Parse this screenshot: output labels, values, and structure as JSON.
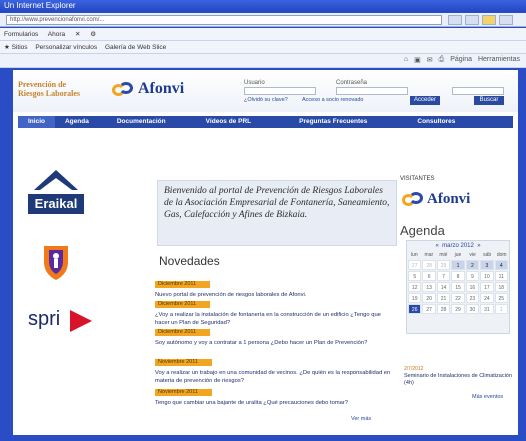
{
  "browser": {
    "title": "Un Internet Explorer",
    "url": "http://www.prevencionafonvi.com/...",
    "menus": [
      "Formularios",
      "Ahora",
      "✕",
      "⚙"
    ],
    "favorites": [
      "★ Sitios",
      "Personalizar vínculos",
      "Galería de Web Slice"
    ],
    "cmd_tools": [
      "⌂",
      "▣",
      "✉",
      "⎙",
      "Página",
      "Herramientas"
    ]
  },
  "site": {
    "prevencion_line1": "Prevención de",
    "prevencion_line2": "Riesgos Laborales",
    "brand": "Afonvi",
    "search": {
      "label_user": "Usuario",
      "label_pass": "Contraseña",
      "link_forgot": "¿Olvidó su clave?",
      "link_register": "Acceso a socio renovado",
      "btn_login": "Acceder",
      "btn_search": "Buscar"
    },
    "nav": [
      "Inicio",
      "Agenda",
      "Documentación",
      "Vídeos de PRL",
      "Preguntas Frecuentes",
      "Consultores"
    ],
    "welcome": "Bienvenido al portal de Prevención de Riesgos Laborales de la Asociación Empresarial de Fontanería, Saneamiento, Gas, Calefacción y Afines de Bizkaia.",
    "novedades_title": "Novedades",
    "news": [
      {
        "date": "Diciembre 2011",
        "text": "Nuevo portal de prevención de riesgos laborales de Afonvi."
      },
      {
        "date": "Diciembre 2011",
        "text": "¿Voy a realizar la instalación de fontanería en la construcción de un edificio ¿Tengo que hacer un Plan de Seguridad?"
      },
      {
        "date": "Diciembre 2011",
        "text": "Soy autónomo y voy a contratar a 1 persona ¿Debo hacer un Plan de Prevención?"
      },
      {
        "date": "Noviembre 2011",
        "text": "Voy a realizar un trabajo en una comunidad de vecinos. ¿De quién es la responsabilidad en materia de prevención de riesgos?"
      },
      {
        "date": "Noviembre 2011",
        "text": "Tengo que cambiar una bajante de uralita ¿Qué precauciones debo tomar?"
      }
    ],
    "ver_mas": "Ver más",
    "visitantes_label": "VISITANTES",
    "agenda_title": "Agenda",
    "calendar": {
      "month": "marzo 2012",
      "prev": "«",
      "next": "»",
      "days": [
        "lun",
        "mar",
        "mié",
        "jue",
        "vie",
        "sáb",
        "dom"
      ],
      "cells": [
        {
          "v": "27",
          "c": "mut"
        },
        {
          "v": "28",
          "c": "mut"
        },
        {
          "v": "29",
          "c": "mut"
        },
        {
          "v": "1",
          "c": "hl"
        },
        {
          "v": "2",
          "c": "hl"
        },
        {
          "v": "3",
          "c": "hl"
        },
        {
          "v": "4",
          "c": "hl"
        },
        {
          "v": "5",
          "c": ""
        },
        {
          "v": "6",
          "c": ""
        },
        {
          "v": "7",
          "c": ""
        },
        {
          "v": "8",
          "c": ""
        },
        {
          "v": "9",
          "c": ""
        },
        {
          "v": "10",
          "c": ""
        },
        {
          "v": "11",
          "c": ""
        },
        {
          "v": "12",
          "c": ""
        },
        {
          "v": "13",
          "c": ""
        },
        {
          "v": "14",
          "c": ""
        },
        {
          "v": "15",
          "c": ""
        },
        {
          "v": "16",
          "c": ""
        },
        {
          "v": "17",
          "c": ""
        },
        {
          "v": "18",
          "c": ""
        },
        {
          "v": "19",
          "c": ""
        },
        {
          "v": "20",
          "c": ""
        },
        {
          "v": "21",
          "c": ""
        },
        {
          "v": "22",
          "c": ""
        },
        {
          "v": "23",
          "c": ""
        },
        {
          "v": "24",
          "c": ""
        },
        {
          "v": "25",
          "c": ""
        },
        {
          "v": "26",
          "c": "ev"
        },
        {
          "v": "27",
          "c": ""
        },
        {
          "v": "28",
          "c": ""
        },
        {
          "v": "29",
          "c": ""
        },
        {
          "v": "30",
          "c": ""
        },
        {
          "v": "31",
          "c": ""
        },
        {
          "v": "1",
          "c": "mut"
        },
        {
          "v": "2",
          "c": "mut"
        },
        {
          "v": "3",
          "c": "mut"
        },
        {
          "v": "4",
          "c": "mut"
        },
        {
          "v": "5",
          "c": "mut"
        },
        {
          "v": "6",
          "c": "mut"
        },
        {
          "v": "7",
          "c": "mut"
        },
        {
          "v": "8",
          "c": "mut"
        }
      ]
    },
    "event_date": "2/7/2012",
    "event_text": "Seminario de Instalaciones de Climatización (4h)",
    "mas_eventos": "Más eventos",
    "logos": {
      "eraikal": "Eraikal",
      "spri": "spri",
      "eusko": "Osalan"
    }
  },
  "colors": {
    "nav": "#2a4aa8",
    "accent": "#f0a623",
    "brand": "#1f3a8f"
  }
}
